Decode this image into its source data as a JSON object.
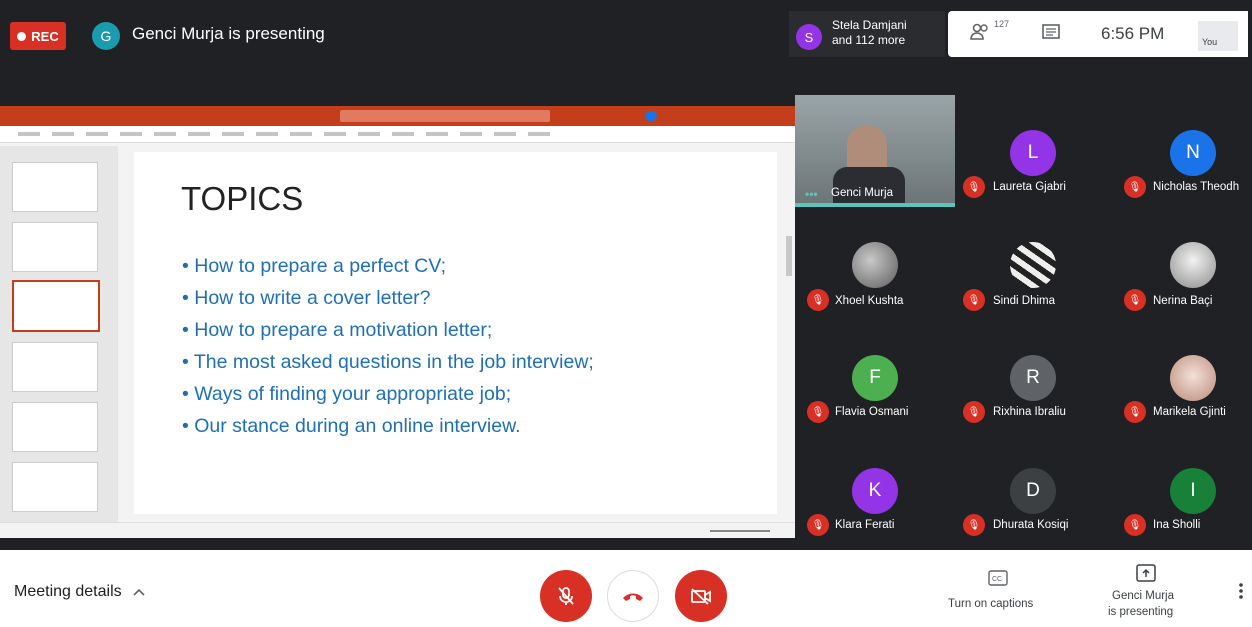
{
  "top": {
    "rec_label": "REC",
    "presenter_initial": "G",
    "presenting_text": "Genci Murja is presenting",
    "speaker_initial": "S",
    "speaker_name": "Stela Damjani",
    "speaker_more": "and 112 more",
    "participants_count": "127",
    "time": "6:56 PM",
    "you_label": "You"
  },
  "slide": {
    "title": "TOPICS",
    "bullets": [
      "• How to prepare a perfect CV;",
      "•  How to write a cover letter?",
      "• How to prepare a motivation letter;",
      "• The most asked questions in the job interview;",
      "• Ways of finding your appropriate job;",
      "• Our stance during an online interview."
    ]
  },
  "tiles": [
    {
      "name": "Genci Murja"
    },
    {
      "name": "Laureta Gjabri",
      "initial": "L",
      "color": "#9334e6"
    },
    {
      "name": "Nicholas Theodh",
      "initial": "N",
      "color": "#1a73e8"
    },
    {
      "name": "Xhoel Kushta"
    },
    {
      "name": "Sindi Dhima"
    },
    {
      "name": "Nerina Baçi"
    },
    {
      "name": "Flavia Osmani",
      "initial": "F",
      "color": "#4caf50"
    },
    {
      "name": "Rixhina Ibraliu",
      "initial": "R",
      "color": "#5f6368"
    },
    {
      "name": "Marikela Gjinti"
    },
    {
      "name": "Klara Ferati",
      "initial": "K",
      "color": "#9334e6"
    },
    {
      "name": "Dhurata Kosiqi",
      "initial": "D",
      "color": "#3c4043"
    },
    {
      "name": "Ina Sholli",
      "initial": "I",
      "color": "#188038"
    }
  ],
  "bottom": {
    "meeting_details": "Meeting details",
    "captions_label": "Turn on captions",
    "present_label_1": "Genci Murja",
    "present_label_2": "is presenting"
  },
  "colors": {
    "meet_bg": "#202124",
    "danger": "#d93025",
    "ppt_accent": "#c43e1c",
    "bullet_blue": "#1f6fb7"
  }
}
